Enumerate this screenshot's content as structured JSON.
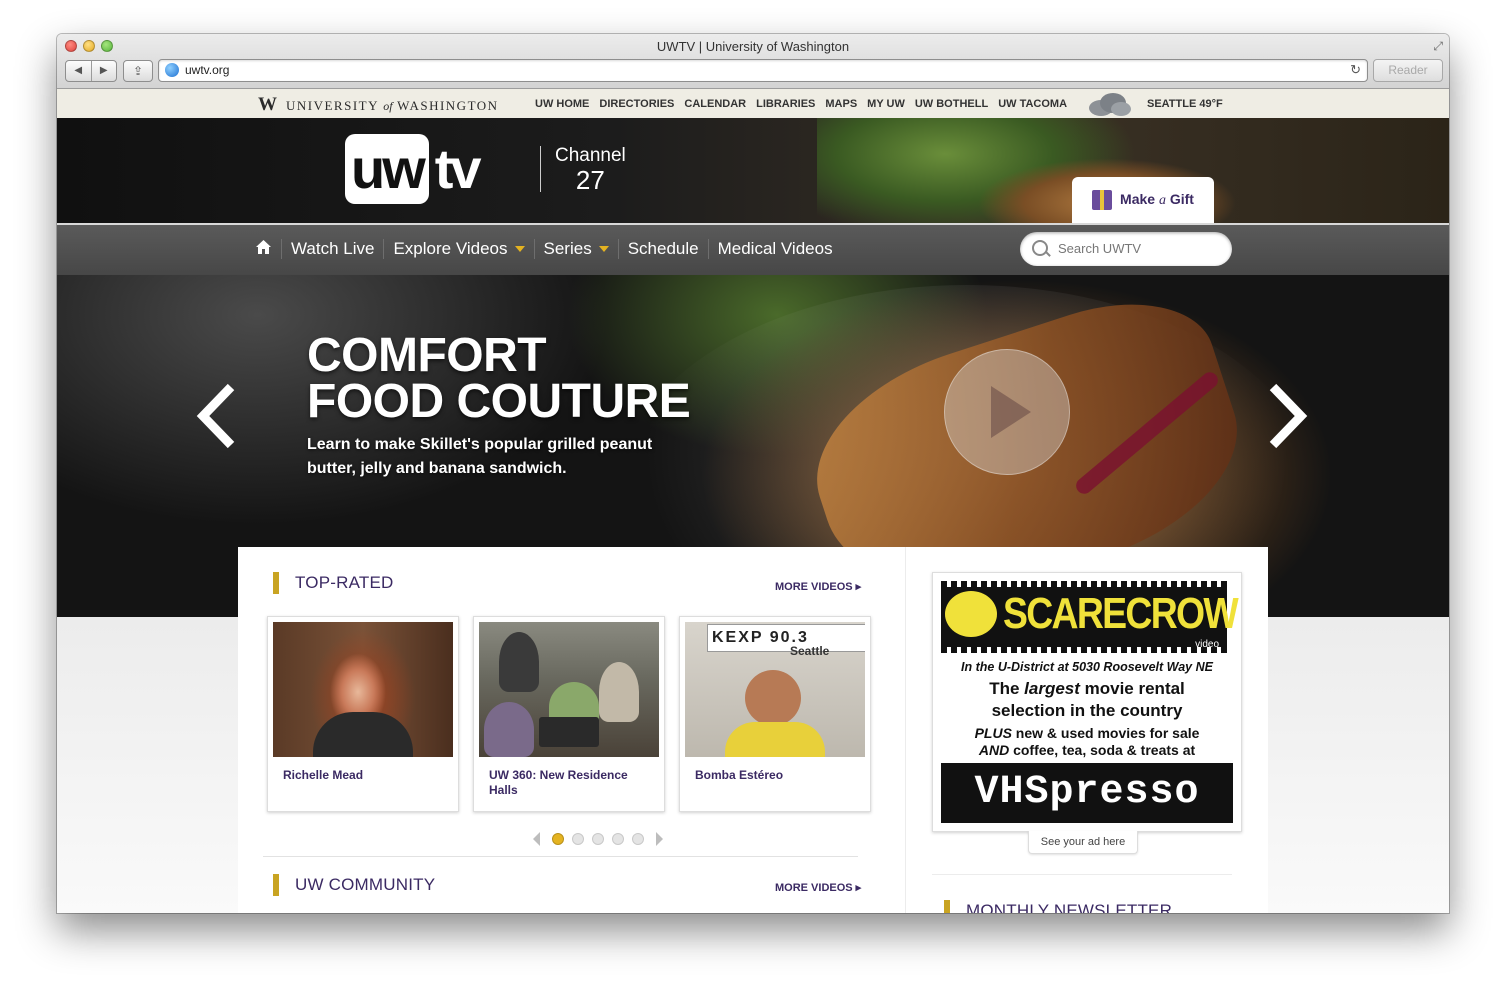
{
  "window": {
    "title": "UWTV | University of Washington",
    "url": "uwtv.org",
    "reader_label": "Reader"
  },
  "uwbar": {
    "logo_w": "W",
    "logo_text_1": "UNIVERSITY",
    "logo_of": "of",
    "logo_text_2": "WASHINGTON",
    "links": [
      "UW HOME",
      "DIRECTORIES",
      "CALENDAR",
      "LIBRARIES",
      "MAPS",
      "MY UW",
      "UW BOTHELL",
      "UW TACOMA"
    ],
    "weather": "SEATTLE 49°F",
    "weather_icon": "cloud-icon"
  },
  "header": {
    "logo_uw": "uw",
    "logo_tv": "tv",
    "channel_label": "Channel",
    "channel_number": "27",
    "gift_make": "Make",
    "gift_a": "a",
    "gift_gift": "Gift"
  },
  "nav": {
    "home_icon": "home-icon",
    "items": [
      "Watch Live",
      "Explore Videos",
      "Series",
      "Schedule",
      "Medical Videos"
    ],
    "search_placeholder": "Search UWTV"
  },
  "hero": {
    "title_line1": "COMFORT",
    "title_line2": "FOOD COUTURE",
    "subtitle": "Learn to make Skillet's popular grilled peanut butter, jelly and banana sandwich."
  },
  "top_rated": {
    "title": "TOP-RATED",
    "more": "MORE VIDEOS ▸",
    "videos": [
      {
        "title": "Richelle Mead"
      },
      {
        "title": "UW 360: New Residence Halls"
      },
      {
        "title": "Bomba Estéreo"
      }
    ],
    "pages": 5,
    "active_page": 1
  },
  "uw_community": {
    "title": "UW COMMUNITY",
    "more": "MORE VIDEOS ▸"
  },
  "ad": {
    "brand": "SCARECROW",
    "brand_sub": "video",
    "line1": "In the U-District at 5030 Roosevelt Way NE",
    "line2a": "The ",
    "line2b": "largest",
    "line2c": " movie rental",
    "line3": "selection in the country",
    "line4a": "PLUS",
    "line4b": " new & used movies for sale",
    "line5a": "AND",
    "line5b": " coffee, tea, soda & treats at",
    "vhs": "VHSpresso",
    "see_ad": "See your ad here"
  },
  "newsletter": {
    "title": "MONTHLY NEWSLETTER"
  },
  "colors": {
    "uw_purple": "#3b2a63",
    "uw_gold": "#e4b321"
  }
}
